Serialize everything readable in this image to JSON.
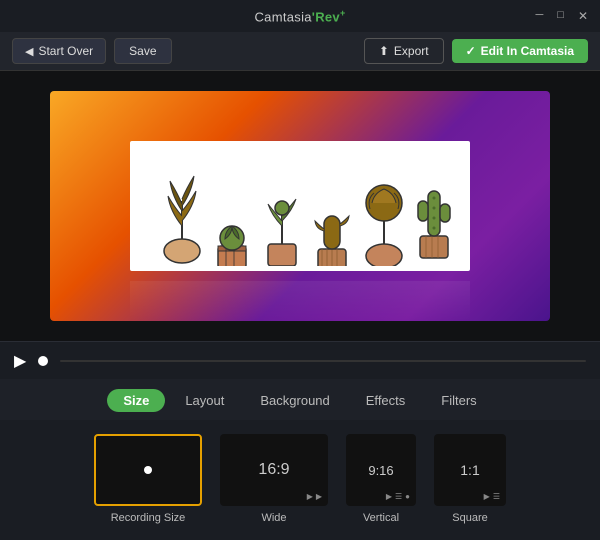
{
  "titlebar": {
    "title": "Camtasia",
    "title_accent": "'Rev",
    "title_plus": "+",
    "controls": [
      "minimize",
      "restore",
      "close"
    ]
  },
  "toolbar": {
    "start_over": "Start Over",
    "save": "Save",
    "export": "Export",
    "edit_camtasia": "Edit In Camtasia",
    "checkmark": "✓"
  },
  "tabs": [
    {
      "id": "size",
      "label": "Size",
      "active": true
    },
    {
      "id": "layout",
      "label": "Layout",
      "active": false
    },
    {
      "id": "background",
      "label": "Background",
      "active": false
    },
    {
      "id": "effects",
      "label": "Effects",
      "active": false
    },
    {
      "id": "filters",
      "label": "Filters",
      "active": false
    }
  ],
  "size_options": [
    {
      "id": "recording",
      "label": "Recording Size",
      "ratio": "",
      "selected": true,
      "has_icons": false
    },
    {
      "id": "wide",
      "label": "Wide",
      "ratio": "16:9",
      "selected": false,
      "has_icons": true,
      "icons": [
        "▶",
        "▶"
      ]
    },
    {
      "id": "vertical",
      "label": "Vertical",
      "ratio": "9:16",
      "selected": false,
      "has_icons": true,
      "icons": [
        "▶",
        "☰",
        "●"
      ]
    },
    {
      "id": "square",
      "label": "Square",
      "ratio": "1:1",
      "selected": false,
      "has_icons": true,
      "icons": [
        "▶",
        "☰"
      ]
    }
  ]
}
